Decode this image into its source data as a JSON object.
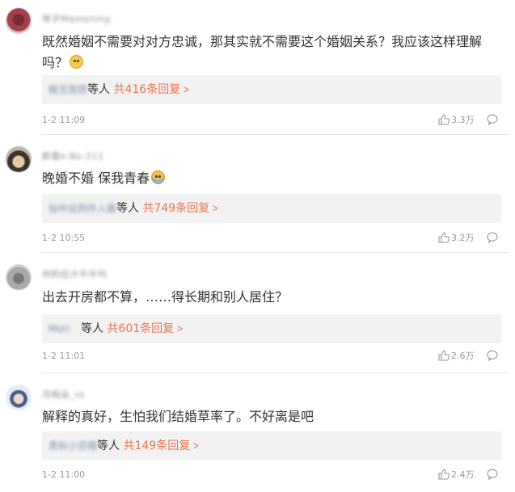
{
  "comments": [
    {
      "username": "琴子Mamoning",
      "text": "既然婚姻不需要对对方忠诚，那其实就不需要这个婚姻关系？我应该这样理解吗？",
      "emoji_icon": "smiling-emoji-icon",
      "reply_names": "敞无悠悠",
      "reply_suffix": "等人",
      "reply_count": "共416条回复",
      "time": "1-2 11:09",
      "likes": "3.3万"
    },
    {
      "username": "醉看k-Bo-211",
      "text": "晚婚不婚 保我青春",
      "emoji_icon": "crying-emoji-icon",
      "reply_names": "仙中出到外人面",
      "reply_suffix": "等人",
      "reply_count": "共749条回复",
      "time": "1-2 10:55",
      "likes": "3.2万"
    },
    {
      "username": "你的后大牛牛吗",
      "text": "出去开房都不算，……得长期和别人居住？",
      "emoji_icon": "",
      "reply_names": "Mori",
      "reply_suffix": "等人",
      "reply_count": "共601条回复",
      "time": "1-2 11:01",
      "likes": "2.6万"
    },
    {
      "username": "月桃朵_ss",
      "text": "解释的真好，生怕我们结婚草率了。不好离是吧",
      "emoji_icon": "",
      "reply_names": "贵秋小恋哦",
      "reply_suffix": "等人",
      "reply_count": "共149条回复",
      "time": "1-2 11:00",
      "likes": "2.4万"
    }
  ],
  "colors": {
    "reply_link": "#eb7350",
    "reply_bg": "#f2f2f2",
    "meta_text": "#999999",
    "username_blur": "#888888"
  }
}
